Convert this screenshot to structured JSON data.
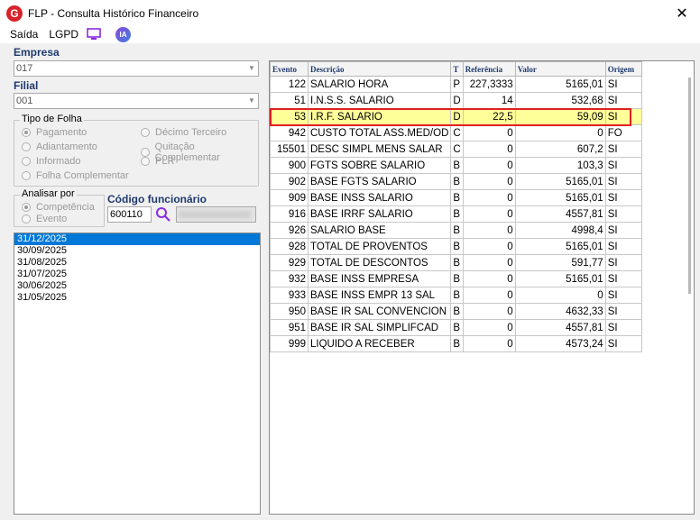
{
  "window": {
    "logo_letter": "G",
    "title": "FLP - Consulta Histórico Financeiro",
    "close_glyph": "✕"
  },
  "menu": {
    "items": [
      "Saída",
      "LGPD"
    ],
    "ia_label": "IA"
  },
  "empresa": {
    "label": "Empresa",
    "value": "017"
  },
  "filial": {
    "label": "Filial",
    "value": "001"
  },
  "tipo_folha": {
    "legend": "Tipo de Folha",
    "options": [
      "Pagamento",
      "Adiantamento",
      "Informado",
      "Folha Complementar",
      "Décimo Terceiro",
      "Quitação Complementar",
      "PLR"
    ],
    "selected": "Pagamento"
  },
  "analisar_por": {
    "legend": "Analisar por",
    "options": [
      "Competência",
      "Evento"
    ],
    "selected": "Competência"
  },
  "codigo_funcionario": {
    "label": "Código funcionário",
    "value": "600110"
  },
  "dates": {
    "items": [
      "31/12/2025",
      "30/09/2025",
      "31/08/2025",
      "31/07/2025",
      "30/06/2025",
      "31/05/2025"
    ],
    "selected_index": 0
  },
  "grid": {
    "columns": [
      "Evento",
      "Descrição",
      "T",
      "Referência",
      "Valor",
      "Origem"
    ],
    "highlighted_index": 2,
    "rows": [
      [
        "122",
        "SALARIO HORA",
        "P",
        "227,3333",
        "5165,01",
        "SI"
      ],
      [
        "51",
        "I.N.S.S. SALARIO",
        "D",
        "14",
        "532,68",
        "SI"
      ],
      [
        "53",
        "I.R.F. SALARIO",
        "D",
        "22,5",
        "59,09",
        "SI"
      ],
      [
        "942",
        "CUSTO TOTAL ASS.MED/OD",
        "C",
        "0",
        "0",
        "FO"
      ],
      [
        "15501",
        "DESC SIMPL MENS SALAR",
        "C",
        "0",
        "607,2",
        "SI"
      ],
      [
        "900",
        "FGTS SOBRE SALARIO",
        "B",
        "0",
        "103,3",
        "SI"
      ],
      [
        "902",
        "BASE FGTS SALARIO",
        "B",
        "0",
        "5165,01",
        "SI"
      ],
      [
        "909",
        "BASE INSS SALARIO",
        "B",
        "0",
        "5165,01",
        "SI"
      ],
      [
        "916",
        "BASE IRRF SALARIO",
        "B",
        "0",
        "4557,81",
        "SI"
      ],
      [
        "926",
        "SALARIO BASE",
        "B",
        "0",
        "4998,4",
        "SI"
      ],
      [
        "928",
        "TOTAL DE PROVENTOS",
        "B",
        "0",
        "5165,01",
        "SI"
      ],
      [
        "929",
        "TOTAL DE DESCONTOS",
        "B",
        "0",
        "591,77",
        "SI"
      ],
      [
        "932",
        "BASE INSS EMPRESA",
        "B",
        "0",
        "5165,01",
        "SI"
      ],
      [
        "933",
        "BASE INSS EMPR 13 SAL",
        "B",
        "0",
        "0",
        "SI"
      ],
      [
        "950",
        "BASE IR SAL CONVENCION",
        "B",
        "0",
        "4632,33",
        "SI"
      ],
      [
        "951",
        "BASE IR SAL SIMPLIFCAD",
        "B",
        "0",
        "4557,81",
        "SI"
      ],
      [
        "999",
        "LIQUIDO A RECEBER",
        "B",
        "0",
        "4573,24",
        "SI"
      ]
    ]
  },
  "colors": {
    "label_blue": "#1f3a6e",
    "selection": "#0078d7",
    "highlight_row": "#ffff99",
    "highlight_border": "#e02020"
  }
}
